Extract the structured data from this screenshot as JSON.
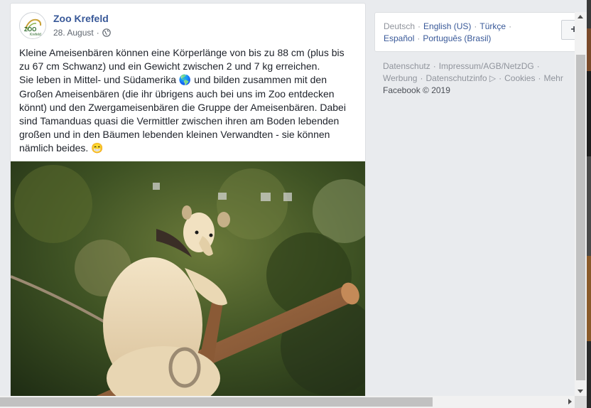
{
  "post": {
    "page_name": "Zoo Krefeld",
    "date": "28. August",
    "dot": "·",
    "avatar_logo": "ZOO Krefeld",
    "text": [
      "Kleine Ameisenbären können eine Körperlänge von bis zu 88 cm (plus bis zu 67 cm Schwanz) und ein Gewicht zwischen 2 und 7 kg erreichen.",
      "Sie leben in Mittel- und Südamerika 🌎 und bilden zusammen mit den Großen Ameisenbären (die ihr übrigens auch bei uns im Zoo entdecken könnt) und den Zwergameisenbären die Gruppe der Ameisenbären. Dabei sind Tamanduas quasi die Vermittler zwischen ihren am Boden lebenden großen und in den Bäumen lebenden kleinen Verwandten - sie können nämlich beides. 😁"
    ],
    "photo_icon": "photo-tamandua-on-branch"
  },
  "languages": {
    "row1": [
      "Deutsch",
      "English (US)",
      "Türkçe"
    ],
    "row2": [
      "Español",
      "Português (Brasil)"
    ],
    "separator": "·",
    "add_button": "+"
  },
  "footer": {
    "row1": [
      "Datenschutz",
      "Impressum/AGB/NetzDG"
    ],
    "row2": [
      "Werbung",
      "Datenschutzinfo ▷",
      "Cookies",
      "Mehr"
    ],
    "copyright": "Facebook © 2019",
    "separator": "·"
  },
  "colors": {
    "link": "#385898",
    "muted": "#90949c",
    "background": "#e9ebee"
  }
}
